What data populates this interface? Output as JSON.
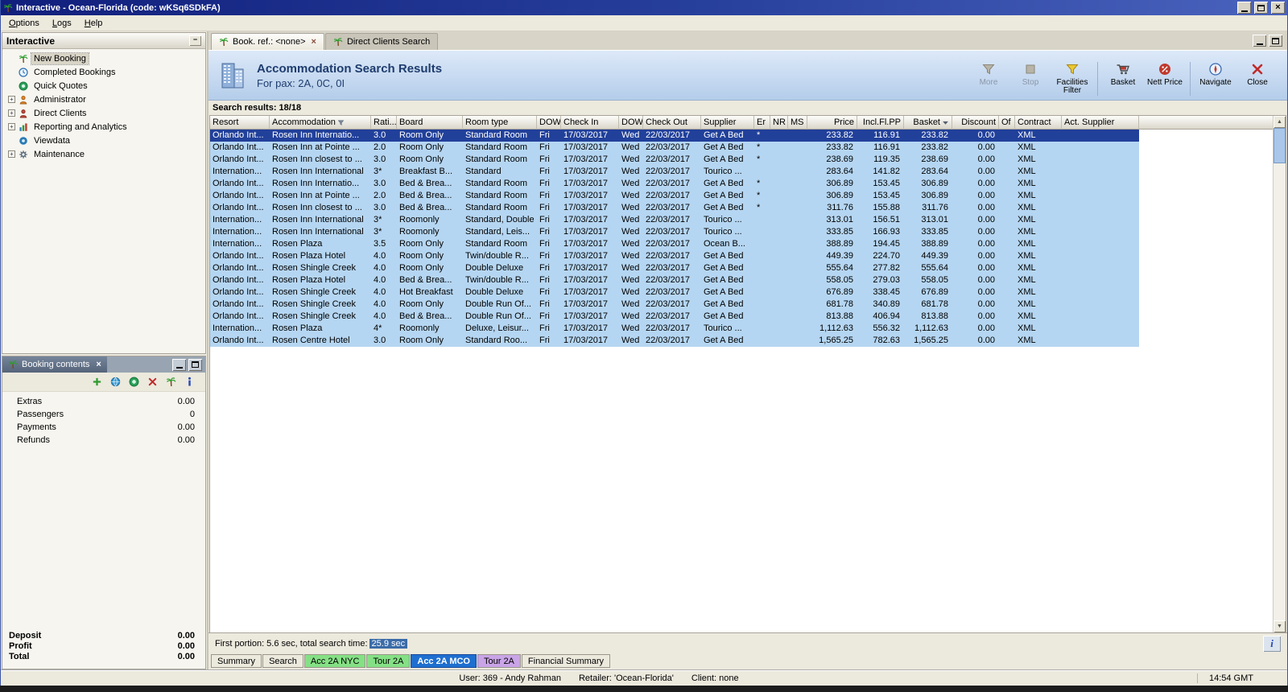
{
  "window": {
    "title": "Interactive - Ocean-Florida (code: wKSq6SDkFA)",
    "time": "14:54 GMT",
    "status_user": "User: 369 - Andy Rahman",
    "status_retailer": "Retailer: 'Ocean-Florida'",
    "status_client": "Client: none"
  },
  "menubar": {
    "items": [
      {
        "label": "Options"
      },
      {
        "label": "Logs"
      },
      {
        "label": "Help"
      }
    ]
  },
  "sidebar": {
    "title": "Interactive",
    "items": [
      {
        "label": "New Booking",
        "icon": "palm-icon",
        "selected": true,
        "expander": false
      },
      {
        "label": "Completed Bookings",
        "icon": "clock-icon",
        "selected": false,
        "expander": false
      },
      {
        "label": "Quick Quotes",
        "icon": "quote-icon",
        "selected": false,
        "expander": false
      },
      {
        "label": "Administrator",
        "icon": "admin-icon",
        "selected": false,
        "expander": true
      },
      {
        "label": "Direct Clients",
        "icon": "clients-icon",
        "selected": false,
        "expander": true
      },
      {
        "label": "Reporting and Analytics",
        "icon": "report-icon",
        "selected": false,
        "expander": true
      },
      {
        "label": "Viewdata",
        "icon": "viewdata-icon",
        "selected": false,
        "expander": false
      },
      {
        "label": "Maintenance",
        "icon": "maintenance-icon",
        "selected": false,
        "expander": true
      }
    ]
  },
  "booking_contents": {
    "title": "Booking contents",
    "toolbar": [
      {
        "icon": "add-icon"
      },
      {
        "icon": "globe-icon"
      },
      {
        "icon": "quote-icon"
      },
      {
        "icon": "delete-icon"
      },
      {
        "icon": "palm-icon"
      },
      {
        "icon": "info-icon"
      }
    ],
    "rows": [
      {
        "label": "Extras",
        "value": "0.00"
      },
      {
        "label": "Passengers",
        "value": "0"
      },
      {
        "label": "Payments",
        "value": "0.00"
      },
      {
        "label": "Refunds",
        "value": "0.00"
      }
    ],
    "totals": [
      {
        "label": "Deposit",
        "value": "0.00"
      },
      {
        "label": "Profit",
        "value": "0.00"
      },
      {
        "label": "Total",
        "value": "0.00"
      }
    ]
  },
  "main": {
    "tabs": [
      {
        "label": "Book. ref.: <none>",
        "active": true,
        "closable": true
      },
      {
        "label": "Direct Clients Search",
        "active": false,
        "closable": false
      }
    ],
    "header": {
      "title": "Accommodation Search Results",
      "subtitle": "For pax: 2A, 0C, 0I"
    },
    "toolbar": [
      {
        "label": "More",
        "icon": "more-filter-icon",
        "disabled": true,
        "sep_after": false
      },
      {
        "label": "Stop",
        "icon": "stop-icon",
        "disabled": true,
        "sep_after": false
      },
      {
        "label": "Facilities Filter",
        "icon": "funnel-icon",
        "disabled": false,
        "sep_after": true
      },
      {
        "label": "Basket",
        "icon": "basket-icon",
        "disabled": false,
        "sep_after": false
      },
      {
        "label": "Nett Price",
        "icon": "nett-price-icon",
        "disabled": false,
        "sep_after": true
      },
      {
        "label": "Navigate",
        "icon": "navigate-icon",
        "disabled": false,
        "sep_after": false
      },
      {
        "label": "Close",
        "icon": "close-icon",
        "disabled": false,
        "sep_after": false
      }
    ],
    "results_label": "Search results: 18/18",
    "footer": {
      "status_prefix": "First portion: 5.6 sec, total search time:",
      "status_highlight": "25.9 sec"
    },
    "bottom_tabs": [
      {
        "label": "Summary",
        "bg": "#ece9dd",
        "fg": "#000000",
        "active": false
      },
      {
        "label": "Search",
        "bg": "#ece9dd",
        "fg": "#000000",
        "active": false
      },
      {
        "label": "Acc 2A NYC",
        "bg": "#85e085",
        "fg": "#000000",
        "active": false
      },
      {
        "label": "Tour 2A",
        "bg": "#85e085",
        "fg": "#000000",
        "active": false
      },
      {
        "label": "Acc 2A MCO",
        "bg": "#1e6fd0",
        "fg": "#ffffff",
        "active": true
      },
      {
        "label": "Tour 2A",
        "bg": "#c9a4e6",
        "fg": "#000000",
        "active": false
      },
      {
        "label": "Financial Summary",
        "bg": "#ece9dd",
        "fg": "#000000",
        "active": false
      }
    ]
  },
  "table": {
    "selected_row": 0,
    "columns": [
      {
        "key": "resort",
        "label": "Resort"
      },
      {
        "key": "accommodation",
        "label": "Accommodation",
        "filter": true
      },
      {
        "key": "rating",
        "label": "Rati..."
      },
      {
        "key": "board",
        "label": "Board"
      },
      {
        "key": "room_type",
        "label": "Room type"
      },
      {
        "key": "dow_in",
        "label": "DOW"
      },
      {
        "key": "check_in",
        "label": "Check In"
      },
      {
        "key": "dow_out",
        "label": "DOW"
      },
      {
        "key": "check_out",
        "label": "Check Out"
      },
      {
        "key": "supplier",
        "label": "Supplier"
      },
      {
        "key": "er",
        "label": "Er"
      },
      {
        "key": "nr",
        "label": "NR"
      },
      {
        "key": "ms",
        "label": "MS"
      },
      {
        "key": "price",
        "label": "Price",
        "align": "right"
      },
      {
        "key": "incl_fl_pp",
        "label": "Incl.Fl.PP",
        "align": "right"
      },
      {
        "key": "basket",
        "label": "Basket",
        "align": "right",
        "sort": true
      },
      {
        "key": "discount",
        "label": "Discount",
        "align": "right"
      },
      {
        "key": "of",
        "label": "Of"
      },
      {
        "key": "contract",
        "label": "Contract"
      },
      {
        "key": "act_supplier",
        "label": "Act. Supplier"
      }
    ],
    "rows": [
      [
        "Orlando Int...",
        "Rosen Inn Internatio...",
        "3.0",
        "Room Only",
        "Standard Room",
        "Fri",
        "17/03/2017",
        "Wed",
        "22/03/2017",
        "Get A Bed",
        "*",
        "",
        "",
        "233.82",
        "116.91",
        "233.82",
        "0.00",
        "",
        "XML",
        ""
      ],
      [
        "Orlando Int...",
        "Rosen Inn at Pointe ...",
        "2.0",
        "Room Only",
        "Standard Room",
        "Fri",
        "17/03/2017",
        "Wed",
        "22/03/2017",
        "Get A Bed",
        "*",
        "",
        "",
        "233.82",
        "116.91",
        "233.82",
        "0.00",
        "",
        "XML",
        ""
      ],
      [
        "Orlando Int...",
        "Rosen Inn closest to ...",
        "3.0",
        "Room Only",
        "Standard Room",
        "Fri",
        "17/03/2017",
        "Wed",
        "22/03/2017",
        "Get A Bed",
        "*",
        "",
        "",
        "238.69",
        "119.35",
        "238.69",
        "0.00",
        "",
        "XML",
        ""
      ],
      [
        "Internation...",
        "Rosen Inn International",
        "3*",
        "Breakfast B...",
        "Standard",
        "Fri",
        "17/03/2017",
        "Wed",
        "22/03/2017",
        "Tourico ...",
        "",
        "",
        "",
        "283.64",
        "141.82",
        "283.64",
        "0.00",
        "",
        "XML",
        ""
      ],
      [
        "Orlando Int...",
        "Rosen Inn Internatio...",
        "3.0",
        "Bed & Brea...",
        "Standard Room",
        "Fri",
        "17/03/2017",
        "Wed",
        "22/03/2017",
        "Get A Bed",
        "*",
        "",
        "",
        "306.89",
        "153.45",
        "306.89",
        "0.00",
        "",
        "XML",
        ""
      ],
      [
        "Orlando Int...",
        "Rosen Inn at Pointe ...",
        "2.0",
        "Bed & Brea...",
        "Standard Room",
        "Fri",
        "17/03/2017",
        "Wed",
        "22/03/2017",
        "Get A Bed",
        "*",
        "",
        "",
        "306.89",
        "153.45",
        "306.89",
        "0.00",
        "",
        "XML",
        ""
      ],
      [
        "Orlando Int...",
        "Rosen Inn closest to ...",
        "3.0",
        "Bed & Brea...",
        "Standard Room",
        "Fri",
        "17/03/2017",
        "Wed",
        "22/03/2017",
        "Get A Bed",
        "*",
        "",
        "",
        "311.76",
        "155.88",
        "311.76",
        "0.00",
        "",
        "XML",
        ""
      ],
      [
        "Internation...",
        "Rosen Inn International",
        "3*",
        "Roomonly",
        "Standard, Double",
        "Fri",
        "17/03/2017",
        "Wed",
        "22/03/2017",
        "Tourico ...",
        "",
        "",
        "",
        "313.01",
        "156.51",
        "313.01",
        "0.00",
        "",
        "XML",
        ""
      ],
      [
        "Internation...",
        "Rosen Inn International",
        "3*",
        "Roomonly",
        "Standard, Leis...",
        "Fri",
        "17/03/2017",
        "Wed",
        "22/03/2017",
        "Tourico ...",
        "",
        "",
        "",
        "333.85",
        "166.93",
        "333.85",
        "0.00",
        "",
        "XML",
        ""
      ],
      [
        "Internation...",
        "Rosen Plaza",
        "3.5",
        "Room Only",
        "Standard Room",
        "Fri",
        "17/03/2017",
        "Wed",
        "22/03/2017",
        "Ocean B...",
        "",
        "",
        "",
        "388.89",
        "194.45",
        "388.89",
        "0.00",
        "",
        "XML",
        ""
      ],
      [
        "Orlando Int...",
        "Rosen Plaza Hotel",
        "4.0",
        "Room Only",
        "Twin/double R...",
        "Fri",
        "17/03/2017",
        "Wed",
        "22/03/2017",
        "Get A Bed",
        "",
        "",
        "",
        "449.39",
        "224.70",
        "449.39",
        "0.00",
        "",
        "XML",
        ""
      ],
      [
        "Orlando Int...",
        "Rosen Shingle Creek",
        "4.0",
        "Room Only",
        "Double Deluxe",
        "Fri",
        "17/03/2017",
        "Wed",
        "22/03/2017",
        "Get A Bed",
        "",
        "",
        "",
        "555.64",
        "277.82",
        "555.64",
        "0.00",
        "",
        "XML",
        ""
      ],
      [
        "Orlando Int...",
        "Rosen Plaza Hotel",
        "4.0",
        "Bed & Brea...",
        "Twin/double R...",
        "Fri",
        "17/03/2017",
        "Wed",
        "22/03/2017",
        "Get A Bed",
        "",
        "",
        "",
        "558.05",
        "279.03",
        "558.05",
        "0.00",
        "",
        "XML",
        ""
      ],
      [
        "Orlando Int...",
        "Rosen Shingle Creek",
        "4.0",
        "Hot Breakfast",
        "Double Deluxe",
        "Fri",
        "17/03/2017",
        "Wed",
        "22/03/2017",
        "Get A Bed",
        "",
        "",
        "",
        "676.89",
        "338.45",
        "676.89",
        "0.00",
        "",
        "XML",
        ""
      ],
      [
        "Orlando Int...",
        "Rosen Shingle Creek",
        "4.0",
        "Room Only",
        "Double Run Of...",
        "Fri",
        "17/03/2017",
        "Wed",
        "22/03/2017",
        "Get A Bed",
        "",
        "",
        "",
        "681.78",
        "340.89",
        "681.78",
        "0.00",
        "",
        "XML",
        ""
      ],
      [
        "Orlando Int...",
        "Rosen Shingle Creek",
        "4.0",
        "Bed & Brea...",
        "Double Run Of...",
        "Fri",
        "17/03/2017",
        "Wed",
        "22/03/2017",
        "Get A Bed",
        "",
        "",
        "",
        "813.88",
        "406.94",
        "813.88",
        "0.00",
        "",
        "XML",
        ""
      ],
      [
        "Internation...",
        "Rosen Plaza",
        "4*",
        "Roomonly",
        "Deluxe, Leisur...",
        "Fri",
        "17/03/2017",
        "Wed",
        "22/03/2017",
        "Tourico ...",
        "",
        "",
        "",
        "1,112.63",
        "556.32",
        "1,112.63",
        "0.00",
        "",
        "XML",
        ""
      ],
      [
        "Orlando Int...",
        "Rosen Centre Hotel",
        "3.0",
        "Room Only",
        "Standard Roo...",
        "Fri",
        "17/03/2017",
        "Wed",
        "22/03/2017",
        "Get A Bed",
        "",
        "",
        "",
        "1,565.25",
        "782.63",
        "1,565.25",
        "0.00",
        "",
        "XML",
        ""
      ]
    ]
  },
  "colors": {
    "selection": "#21409a",
    "row_highlight": "#b5d6f2",
    "titlebar": "#111f7c",
    "header_band": "#c8dcf4"
  }
}
